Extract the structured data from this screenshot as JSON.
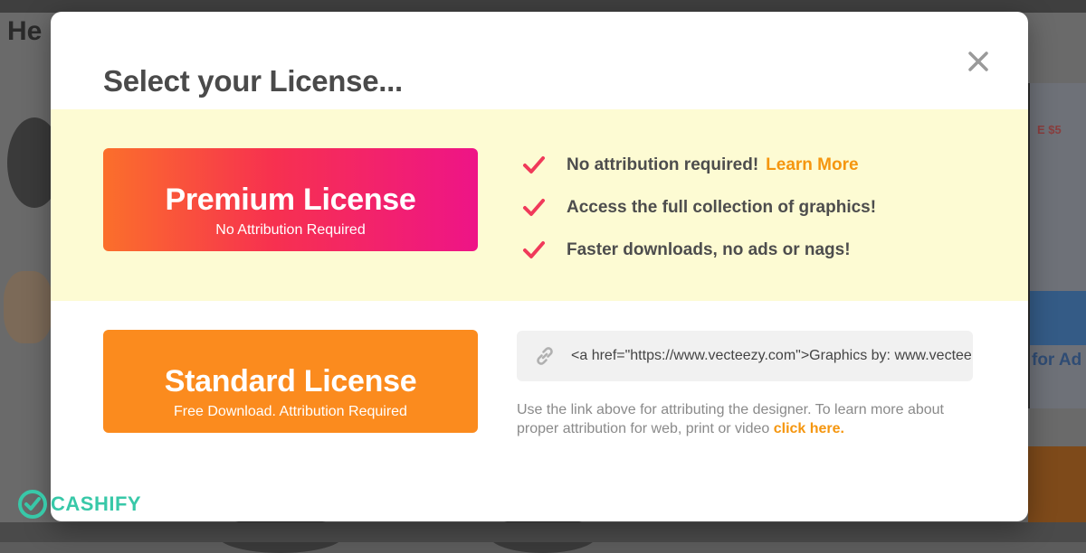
{
  "background": {
    "title_fragment": "He",
    "right_text_top": "E $5",
    "right_text_ad": "for Ad"
  },
  "modal": {
    "title": "Select your License...",
    "close_icon": "close-icon"
  },
  "premium": {
    "name": "Premium License",
    "subtitle": "No Attribution Required",
    "features": [
      {
        "text": "No attribution required!",
        "link": "Learn More"
      },
      {
        "text": "Access the full collection of graphics!"
      },
      {
        "text": "Faster downloads, no ads or nags!"
      }
    ]
  },
  "standard": {
    "name": "Standard License",
    "subtitle": "Free Download. Attribution Required",
    "attribution_code": "<a href=\"https://www.vecteezy.com\">Graphics by: www.vecteezy.com</a>",
    "help_text": "Use the link above for attributing the designer. To learn more about proper attribution for web, print or video",
    "help_link": "click here."
  },
  "watermark": {
    "text": "CASHIFY"
  },
  "colors": {
    "accent_orange": "#f5960f",
    "check_red": "#f03a5a",
    "premium_band": "#fdfbd3",
    "standard_button": "#fb8b1e",
    "watermark": "#38c8a8"
  }
}
